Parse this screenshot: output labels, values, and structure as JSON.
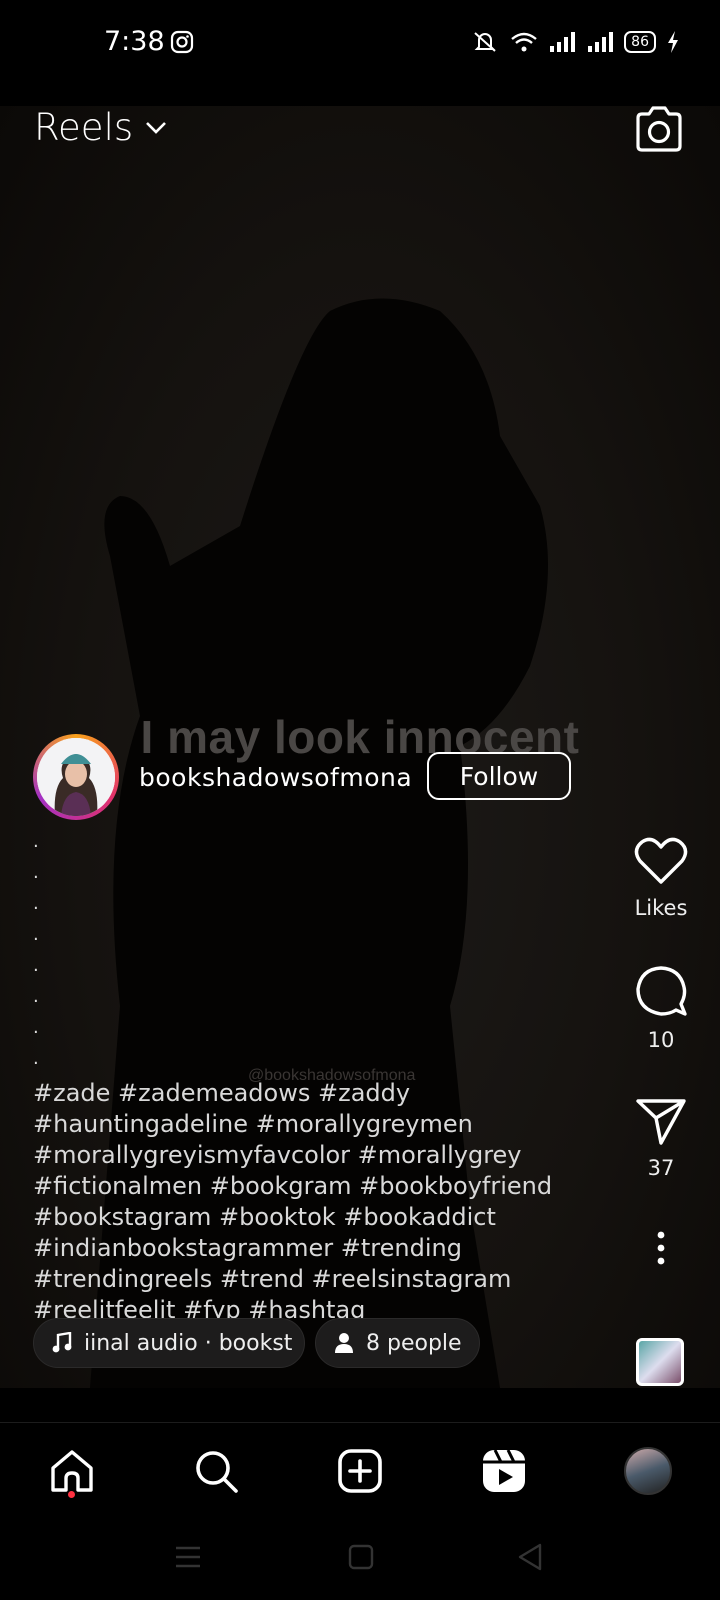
{
  "status_bar": {
    "time": "7:38",
    "battery": "86"
  },
  "header": {
    "title": "Reels"
  },
  "video": {
    "overlay_text": "I may look innocent",
    "watermark": "@bookshadowsofmona"
  },
  "author": {
    "username": "bookshadowsofmona",
    "follow_label": "Follow"
  },
  "caption": {
    "dots": [
      ".",
      ".",
      ".",
      ".",
      ".",
      ".",
      ".",
      "."
    ],
    "lines": [
      "#zade #zademeadows #zaddy",
      "#hauntingadeline #morallygreymen",
      "#morallygreyismyfavcolor #morallygrey",
      "#fictionalmen #bookgram #bookboyfriend",
      "#bookstagram #booktok #bookaddict",
      "#indianbookstagrammer #trending",
      "#trendingreels #trend #reelsinstagram",
      "#reelitfeelit #fyp #hashtag"
    ]
  },
  "audio": {
    "label": "iinal audio · bookst"
  },
  "people": {
    "label": "8 people"
  },
  "actions": {
    "likes_label": "Likes",
    "comments_count": "10",
    "shares_count": "37"
  },
  "icons": [
    "instagram-icon",
    "mute-icon",
    "wifi-icon",
    "signal-icon",
    "battery-icon",
    "chevron-down-icon",
    "camera-icon",
    "heart-icon",
    "comment-icon",
    "send-icon",
    "more-icon",
    "music-icon",
    "person-icon",
    "home-icon",
    "search-icon",
    "add-icon",
    "reels-icon"
  ],
  "colors": {
    "accent_dot": "#ff3040",
    "ring_start": "#f9a11b",
    "ring_end": "#a431c4"
  }
}
